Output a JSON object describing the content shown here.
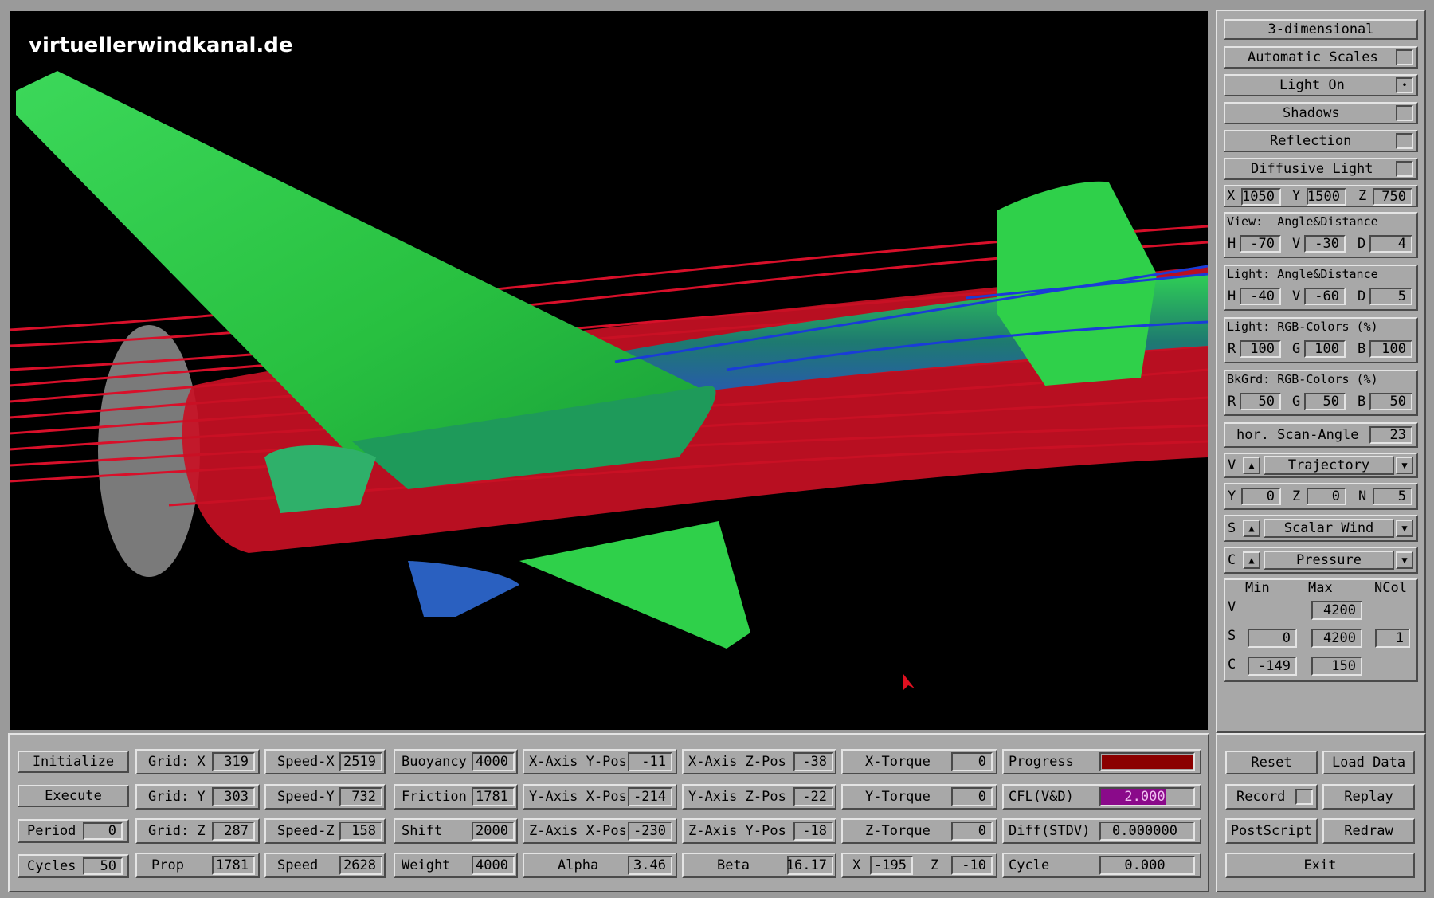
{
  "watermark": "virtuellerwindkanal.de",
  "side": {
    "mode_button": "3-dimensional",
    "toggles": [
      {
        "label": "Automatic Scales",
        "checked": false
      },
      {
        "label": "Light On",
        "checked": true
      },
      {
        "label": "Shadows",
        "checked": false
      },
      {
        "label": "Reflection",
        "checked": false
      },
      {
        "label": "Diffusive Light",
        "checked": false
      }
    ],
    "xyz": {
      "x_label": "X",
      "x": "1050",
      "y_label": "Y",
      "y": "1500",
      "z_label": "Z",
      "z": "750"
    },
    "view": {
      "title": "View:  Angle&Distance",
      "h_label": "H",
      "h": "-70",
      "v_label": "V",
      "v": "-30",
      "d_label": "D",
      "d": "4"
    },
    "light_angle": {
      "title": "Light: Angle&Distance",
      "h_label": "H",
      "h": "-40",
      "v_label": "V",
      "v": "-60",
      "d_label": "D",
      "d": "5"
    },
    "light_rgb": {
      "title": "Light: RGB-Colors (%)",
      "r_label": "R",
      "r": "100",
      "g_label": "G",
      "g": "100",
      "b_label": "B",
      "b": "100"
    },
    "bkgrd_rgb": {
      "title": "BkGrd: RGB-Colors (%)",
      "r_label": "R",
      "r": "50",
      "g_label": "G",
      "g": "50",
      "b_label": "B",
      "b": "50"
    },
    "scan": {
      "label": "hor. Scan-Angle",
      "value": "23"
    },
    "v_select": {
      "prefix": "V",
      "value": "Trajectory"
    },
    "yzn": {
      "y_label": "Y",
      "y": "0",
      "z_label": "Z",
      "z": "0",
      "n_label": "N",
      "n": "5"
    },
    "s_select": {
      "prefix": "S",
      "value": "Scalar Wind"
    },
    "c_select": {
      "prefix": "C",
      "value": "Pressure"
    },
    "scale": {
      "min_header": "Min",
      "max_header": "Max",
      "ncol_header": "NCol",
      "v_label": "V",
      "v_max": "4200",
      "s_label": "S",
      "s_min": "0",
      "s_max": "4200",
      "s_ncol": "1",
      "c_label": "C",
      "c_min": "-149",
      "c_max": "150"
    }
  },
  "bottom": {
    "initialize": "Initialize",
    "execute": "Execute",
    "period_label": "Period",
    "period": "0",
    "cycles_label": "Cycles",
    "cycles": "50",
    "gridx_label": "Grid: X",
    "gridx": "319",
    "gridy_label": "Grid: Y",
    "gridy": "303",
    "gridz_label": "Grid: Z",
    "gridz": "287",
    "prop_label": "Prop",
    "prop": "1781",
    "speedx_label": "Speed-X",
    "speedx": "2519",
    "speedy_label": "Speed-Y",
    "speedy": "732",
    "speedz_label": "Speed-Z",
    "speedz": "158",
    "speed_label": "Speed",
    "speed": "2628",
    "buoyancy_label": "Buoyancy",
    "buoyancy": "4000",
    "friction_label": "Friction",
    "friction": "1781",
    "shift_label": "Shift",
    "shift": "2000",
    "weight_label": "Weight",
    "weight": "4000",
    "xaxis_ypos_label": "X-Axis Y-Pos",
    "xaxis_ypos": "-11",
    "yaxis_xpos_label": "Y-Axis X-Pos",
    "yaxis_xpos": "-214",
    "zaxis_xpos_label": "Z-Axis X-Pos",
    "zaxis_xpos": "-230",
    "alpha_label": "Alpha",
    "alpha": "3.46",
    "xaxis_zpos_label": "X-Axis Z-Pos",
    "xaxis_zpos": "-38",
    "yaxis_zpos_label": "Y-Axis Z-Pos",
    "yaxis_zpos": "-22",
    "zaxis_ypos_label": "Z-Axis Y-Pos",
    "zaxis_ypos": "-18",
    "beta_label": "Beta",
    "beta": "16.17",
    "xtorque_label": "X-Torque",
    "xtorque": "0",
    "ytorque_label": "Y-Torque",
    "ytorque": "0",
    "ztorque_label": "Z-Torque",
    "ztorque": "0",
    "x_label": "X",
    "x": "-195",
    "z_label": "Z",
    "z": "-10",
    "progress_label": "Progress",
    "progress": 1.0,
    "cfl_label": "CFL(V&D)",
    "cfl": "2.000",
    "diff_label": "Diff(STDV)",
    "diff": "0.000000",
    "cycle_label": "Cycle",
    "cycle": "0.000",
    "reset": "Reset",
    "load_data": "Load Data",
    "record": "Record",
    "replay": "Replay",
    "postscript": "PostScript",
    "redraw": "Redraw",
    "exit": "Exit"
  },
  "colors": {
    "progress": "#8b0000",
    "cfl": "#8a0a8a",
    "stream_red": "#e0102a",
    "wing_green": "#2fd04a",
    "blue": "#1a3cd8"
  }
}
